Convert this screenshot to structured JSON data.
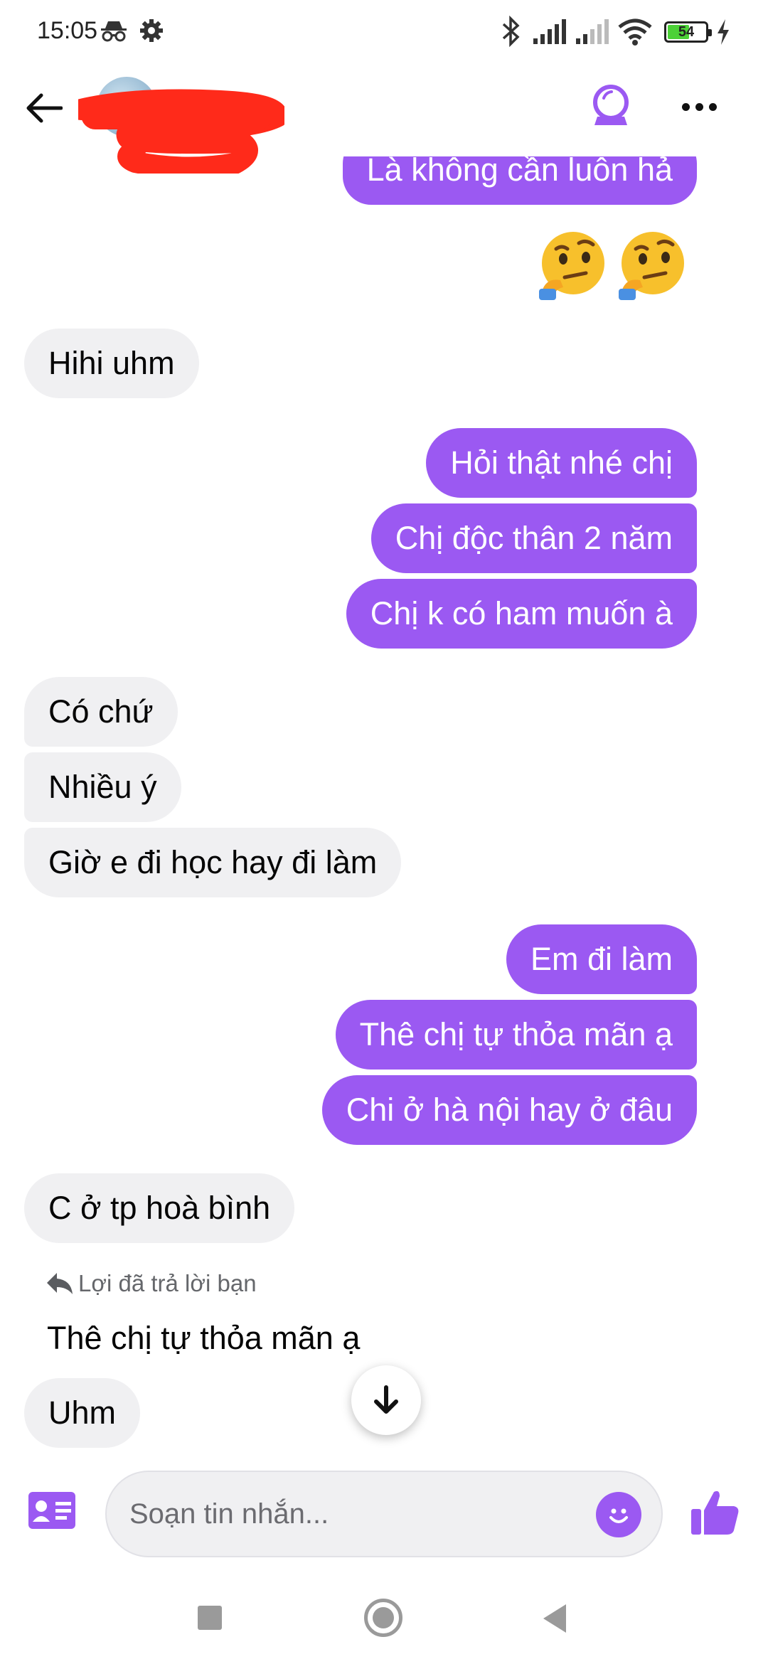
{
  "status_bar": {
    "time": "15:05",
    "battery_level": "54",
    "battery_fraction": 0.54
  },
  "header": {
    "contact_name": "",
    "call_icon": "video-call-icon",
    "more_icon": "more-icon"
  },
  "messages": [
    {
      "id": "m1",
      "direction": "out",
      "text": "Là không cần luôn hả"
    },
    {
      "id": "m2",
      "direction": "out",
      "type": "emoji",
      "emoji": "🤔🤔"
    },
    {
      "id": "m3",
      "direction": "in",
      "text": "Hihi uhm"
    },
    {
      "id": "m4",
      "direction": "out",
      "text": "Hỏi thật nhé chị"
    },
    {
      "id": "m5",
      "direction": "out",
      "text": "Chị độc thân 2 năm"
    },
    {
      "id": "m6",
      "direction": "out",
      "text": "Chị k có ham muốn à"
    },
    {
      "id": "m7",
      "direction": "in",
      "text": "Có chứ"
    },
    {
      "id": "m8",
      "direction": "in",
      "text": "Nhiều ý"
    },
    {
      "id": "m9",
      "direction": "in",
      "text": "Giờ e đi học hay đi làm"
    },
    {
      "id": "m10",
      "direction": "out",
      "text": "Em đi làm"
    },
    {
      "id": "m11",
      "direction": "out",
      "text": "Thê chị tự thỏa mãn ạ"
    },
    {
      "id": "m12",
      "direction": "out",
      "text": "Chi ở hà nội hay ở đâu"
    },
    {
      "id": "m13",
      "direction": "in",
      "text": "C ở tp hoà bình"
    },
    {
      "id": "m14",
      "direction": "in",
      "text": "Uhm"
    }
  ],
  "reply": {
    "label": "Lợi đã trả lời bạn",
    "quoted_text": "Thê chị tự thỏa mãn ạ"
  },
  "composer": {
    "placeholder": "Soạn tin nhắn...",
    "value": ""
  },
  "colors": {
    "accent": "#9b59f2",
    "incoming_bubble": "#f0f0f2",
    "redaction": "#ff2a1a"
  }
}
